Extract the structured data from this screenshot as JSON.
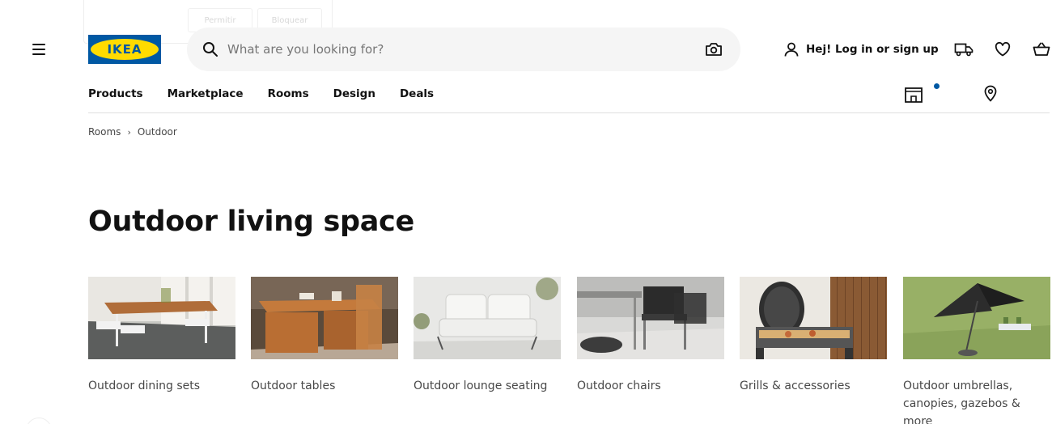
{
  "popup": {
    "allow_label": "Permitir",
    "block_label": "Bloquear"
  },
  "brand": {
    "logo_text": "IKEA",
    "blue": "#0058a3",
    "yellow": "#ffdb00"
  },
  "search": {
    "placeholder": "What are you looking for?",
    "value": ""
  },
  "header": {
    "login_label": "Hej! Log in or sign up",
    "icons": [
      "menu-icon",
      "search-icon",
      "camera-icon",
      "user-icon",
      "delivery-truck-icon",
      "heart-icon",
      "shopping-bag-icon",
      "store-icon",
      "location-pin-icon"
    ]
  },
  "nav": {
    "items": [
      {
        "label": "Products"
      },
      {
        "label": "Marketplace"
      },
      {
        "label": "Rooms"
      },
      {
        "label": "Design"
      },
      {
        "label": "Deals"
      }
    ]
  },
  "breadcrumb": {
    "items": [
      "Rooms",
      "Outdoor"
    ],
    "separator": "›"
  },
  "page": {
    "title": "Outdoor living space"
  },
  "categories": [
    {
      "label": "Outdoor dining sets"
    },
    {
      "label": "Outdoor tables"
    },
    {
      "label": "Outdoor lounge seating"
    },
    {
      "label": "Outdoor chairs"
    },
    {
      "label": "Grills & accessories"
    },
    {
      "label": "Outdoor umbrellas, canopies, gazebos & more"
    }
  ]
}
